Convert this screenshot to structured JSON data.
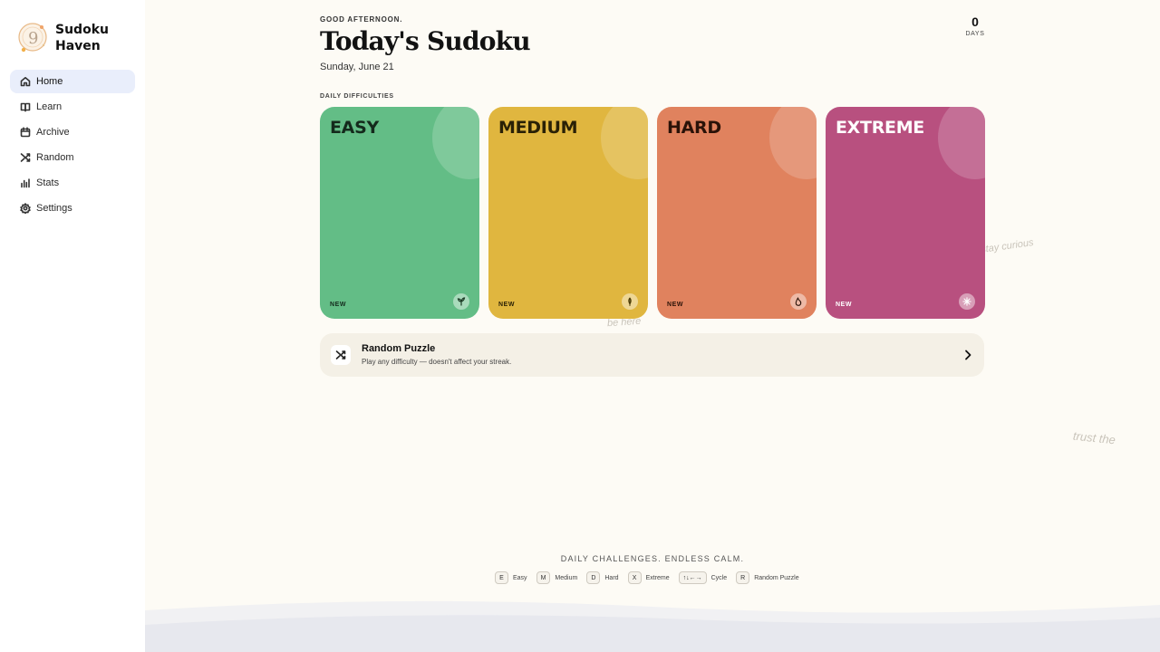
{
  "brand": {
    "name": "Sudoku Haven",
    "logo_icon": "nine-badge-icon"
  },
  "sidebar": {
    "items": [
      {
        "label": "Home",
        "icon": "home-icon",
        "active": true
      },
      {
        "label": "Learn",
        "icon": "book-icon",
        "active": false
      },
      {
        "label": "Archive",
        "icon": "calendar-icon",
        "active": false
      },
      {
        "label": "Random",
        "icon": "shuffle-icon",
        "active": false
      },
      {
        "label": "Stats",
        "icon": "bar-chart-icon",
        "active": false
      },
      {
        "label": "Settings",
        "icon": "gear-icon",
        "active": false
      }
    ]
  },
  "header": {
    "greeting": "GOOD AFTERNOON.",
    "title": "Today's Sudoku",
    "date": "Sunday, June 21",
    "streak": {
      "value": "0",
      "label": "DAYS"
    }
  },
  "difficulties": {
    "section_label": "DAILY DIFFICULTIES",
    "cards": [
      {
        "title": "EASY",
        "status": "NEW",
        "icon": "sprout-icon",
        "color": "#63bd86",
        "text_color": "#142a1c"
      },
      {
        "title": "MEDIUM",
        "status": "NEW",
        "icon": "feather-icon",
        "color": "#e0b63f",
        "text_color": "#2a2106"
      },
      {
        "title": "HARD",
        "status": "NEW",
        "icon": "flame-icon",
        "color": "#e0825e",
        "text_color": "#2a1208"
      },
      {
        "title": "EXTREME",
        "status": "NEW",
        "icon": "sparkle-icon",
        "color": "#b8507f",
        "text_color": "#ffffff"
      }
    ]
  },
  "watermarks": [
    "stay curious",
    "be here",
    "trust the"
  ],
  "random_puzzle": {
    "title": "Random Puzzle",
    "subtitle": "Play any difficulty — doesn't affect your streak.",
    "icon": "shuffle-icon"
  },
  "footer": {
    "tagline": "DAILY CHALLENGES. ENDLESS CALM.",
    "shortcuts": [
      {
        "key": "E",
        "label": "Easy"
      },
      {
        "key": "M",
        "label": "Medium"
      },
      {
        "key": "D",
        "label": "Hard"
      },
      {
        "key": "X",
        "label": "Extreme"
      },
      {
        "key": "↑↓←→",
        "label": "Cycle"
      },
      {
        "key": "R",
        "label": "Random Puzzle"
      }
    ]
  }
}
